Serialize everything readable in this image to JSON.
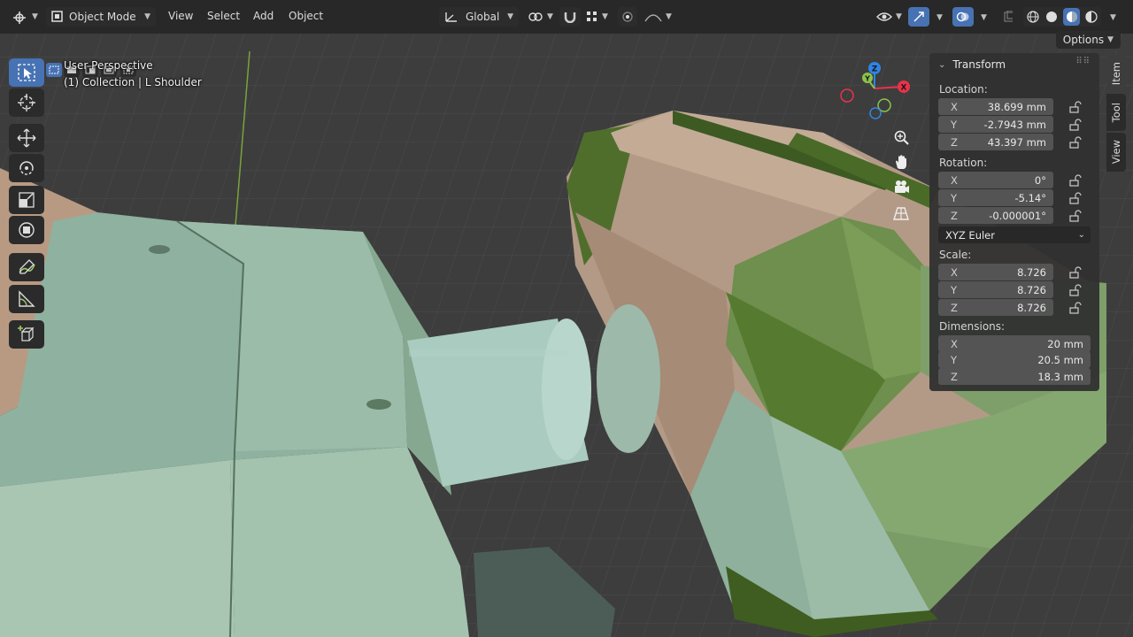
{
  "header": {
    "editor_type_icon": "viewport-icon",
    "mode_label": "Object Mode",
    "menus": [
      "View",
      "Select",
      "Add",
      "Object"
    ],
    "orientation_label": "Global",
    "options_label": "Options"
  },
  "viewport": {
    "perspective_label": "User Perspective",
    "collection_label": "(1) Collection | L Shoulder"
  },
  "gizmo": {
    "x": "X",
    "y": "Y",
    "z": "Z"
  },
  "npanel": {
    "panel_title": "Transform",
    "location_label": "Location:",
    "location": [
      {
        "axis": "X",
        "value": "38.699 mm"
      },
      {
        "axis": "Y",
        "value": "-2.7943 mm"
      },
      {
        "axis": "Z",
        "value": "43.397 mm"
      }
    ],
    "rotation_label": "Rotation:",
    "rotation": [
      {
        "axis": "X",
        "value": "0°"
      },
      {
        "axis": "Y",
        "value": "-5.14°"
      },
      {
        "axis": "Z",
        "value": "-0.000001°"
      }
    ],
    "rotation_mode": "XYZ Euler",
    "scale_label": "Scale:",
    "scale": [
      {
        "axis": "X",
        "value": "8.726"
      },
      {
        "axis": "Y",
        "value": "8.726"
      },
      {
        "axis": "Z",
        "value": "8.726"
      }
    ],
    "dimensions_label": "Dimensions:",
    "dimensions": [
      {
        "axis": "X",
        "value": "20 mm"
      },
      {
        "axis": "Y",
        "value": "20.5 mm"
      },
      {
        "axis": "Z",
        "value": "18.3 mm"
      }
    ]
  },
  "side_tabs": [
    "Item",
    "Tool",
    "View"
  ],
  "colors": {
    "active_blue": "#4772b3",
    "axis_x": "#e8334a",
    "axis_y": "#8bc34a",
    "axis_z": "#2f84e3"
  }
}
